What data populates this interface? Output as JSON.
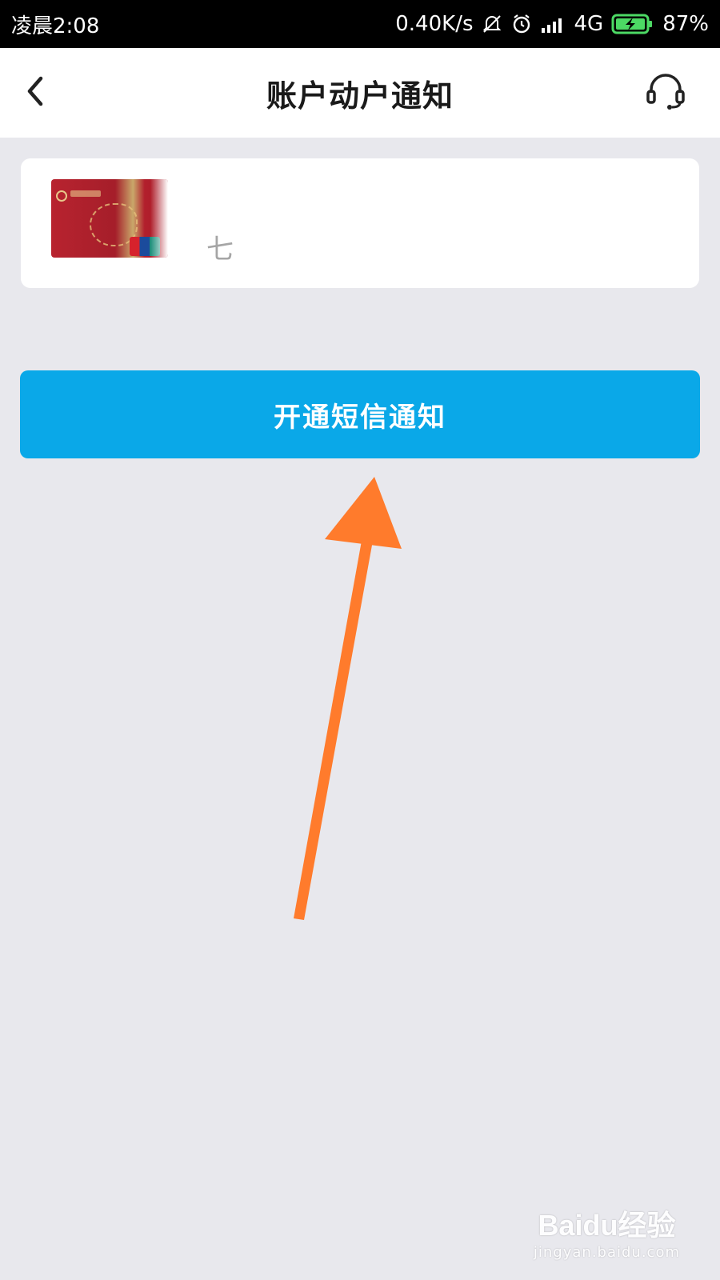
{
  "status_bar": {
    "time": "凌晨2:08",
    "network_speed": "0.40K/s",
    "network_type": "4G",
    "battery_percent": "87%",
    "icons": [
      "mute-bell-icon",
      "alarm-icon",
      "signal-icon",
      "battery-charging-icon"
    ]
  },
  "nav": {
    "title": "账户动户通知",
    "back_icon": "chevron-left-icon",
    "service_icon": "headset-icon"
  },
  "account_card": {
    "card_image": "bank-card-image",
    "visible_text": "七"
  },
  "actions": {
    "open_sms_label": "开通短信通知"
  },
  "annotation": {
    "type": "arrow",
    "color": "#ff7b2c",
    "target": "open-sms-button"
  },
  "watermark": {
    "brand": "Baidu经验",
    "url": "jingyan.baidu.com"
  },
  "colors": {
    "accent": "#0aa8e8",
    "background": "#e8e8ed",
    "arrow": "#ff7b2c"
  }
}
